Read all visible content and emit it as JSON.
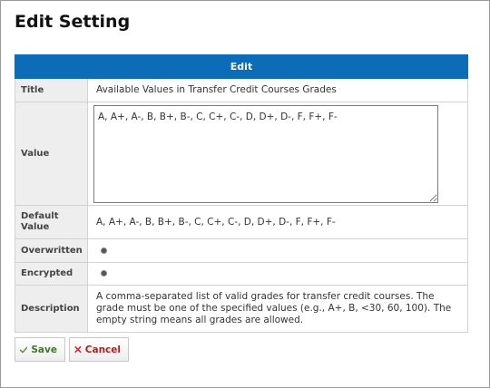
{
  "dialog": {
    "title": "Edit Setting"
  },
  "table": {
    "header": "Edit",
    "rows": {
      "title": {
        "label": "Title",
        "value": "Available Values in Transfer Credit Courses Grades"
      },
      "value": {
        "label": "Value",
        "input_value": "A, A+, A-, B, B+, B-, C, C+, C-, D, D+, D-, F, F+, F-"
      },
      "default_value": {
        "label": "Default Value",
        "value": "A, A+, A-, B, B+, B-, C, C+, C-, D, D+, D-, F, F+, F-"
      },
      "overwritten": {
        "label": "Overwritten"
      },
      "encrypted": {
        "label": "Encrypted"
      },
      "description": {
        "label": "Description",
        "value": "A comma-separated list of valid grades for transfer credit courses. The grade must be one of the specified values (e.g., A+, B, <30, 60, 100). The empty string means all grades are allowed."
      }
    }
  },
  "buttons": {
    "save_label": "Save",
    "cancel_label": "Cancel"
  },
  "colors": {
    "header_bg": "#0c6cb8",
    "save_green": "#3a7a25",
    "cancel_red": "#b02020"
  },
  "icons": {
    "save": "checkmark-icon",
    "cancel": "x-icon"
  }
}
